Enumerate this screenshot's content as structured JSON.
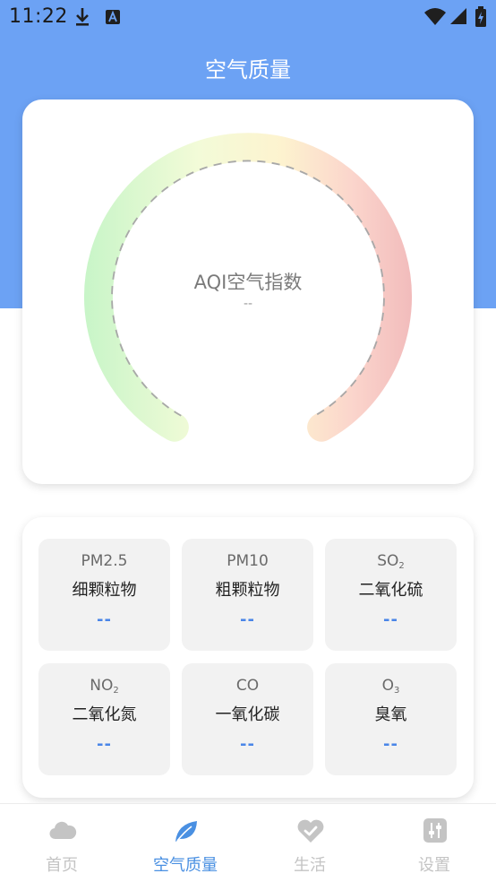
{
  "status_bar": {
    "time": "11:22",
    "left_icons": [
      "download-icon",
      "app-a-icon"
    ],
    "right_icons": [
      "wifi-icon",
      "signal-icon",
      "battery-charging-icon"
    ]
  },
  "header": {
    "title": "空气质量",
    "background_color": "#6ca2f4"
  },
  "gauge": {
    "label": "AQI空气指数",
    "value": "--",
    "gradient_colors": [
      "#c8f5c8",
      "#f3fbd8",
      "#fdf3cf",
      "#fbd5cc",
      "#f2bcbc"
    ]
  },
  "pollutants": [
    {
      "code": "PM2.5",
      "sub": "",
      "name": "细颗粒物",
      "value": "--"
    },
    {
      "code": "PM10",
      "sub": "",
      "name": "粗颗粒物",
      "value": "--"
    },
    {
      "code": "SO",
      "sub": "2",
      "name": "二氧化硫",
      "value": "--"
    },
    {
      "code": "NO",
      "sub": "2",
      "name": "二氧化氮",
      "value": "--"
    },
    {
      "code": "CO",
      "sub": "",
      "name": "一氧化碳",
      "value": "--"
    },
    {
      "code": "O",
      "sub": "3",
      "name": "臭氧",
      "value": "--"
    }
  ],
  "bottom_nav": {
    "active_index": 1,
    "active_color": "#4a90e2",
    "items": [
      {
        "label": "首页",
        "icon": "cloud-icon"
      },
      {
        "label": "空气质量",
        "icon": "leaf-icon"
      },
      {
        "label": "生活",
        "icon": "heart-check-icon"
      },
      {
        "label": "设置",
        "icon": "settings-sliders-icon"
      }
    ]
  }
}
